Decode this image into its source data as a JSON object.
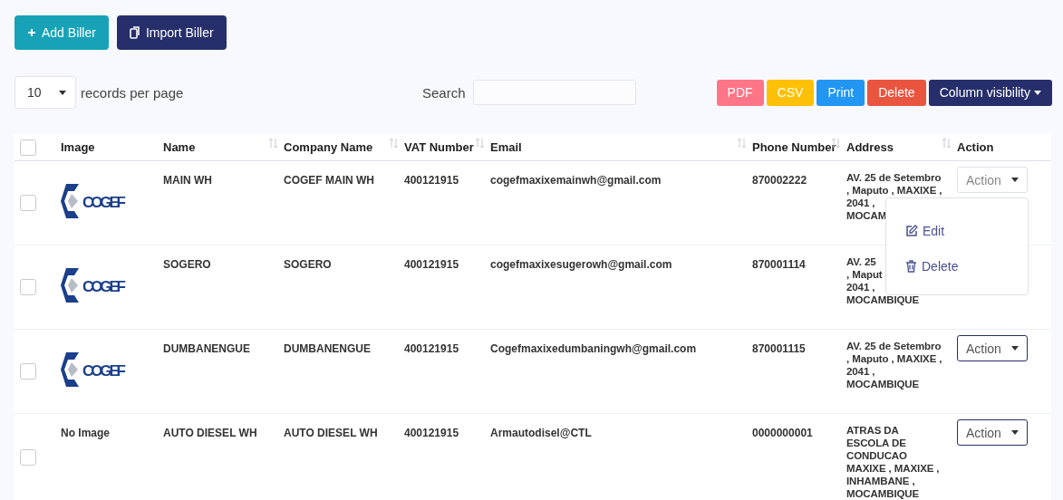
{
  "top_buttons": [
    {
      "kind": "add",
      "label": "Add Biller"
    },
    {
      "kind": "import",
      "label": "Import Biller"
    }
  ],
  "page_size": {
    "value": "10",
    "label": "records per page"
  },
  "search": {
    "label": "Search"
  },
  "export_buttons": [
    {
      "kind": "pdf",
      "label": "PDF"
    },
    {
      "kind": "csv",
      "label": "CSV"
    },
    {
      "kind": "print",
      "label": "Print"
    },
    {
      "kind": "delete",
      "label": "Delete"
    },
    {
      "kind": "columns",
      "label": "Column visibility"
    }
  ],
  "table": {
    "select_all": {
      "checked": false
    },
    "columns": [
      {
        "label": "Image",
        "sortable": false
      },
      {
        "label": "Name",
        "sortable": true
      },
      {
        "label": "Company Name",
        "sortable": true
      },
      {
        "label": "VAT Number",
        "sortable": true
      },
      {
        "label": "Email",
        "sortable": true
      },
      {
        "label": "Phone Number",
        "sortable": true
      },
      {
        "label": "Address",
        "sortable": true
      },
      {
        "label": "Action",
        "sortable": false
      }
    ],
    "rows": [
      {
        "checked": false,
        "image": {
          "kind": "logo",
          "text": "COGEF"
        },
        "name": "MAIN WH",
        "company": "COGEF MAIN WH",
        "vat": "400121915",
        "email": "cogefmaxixemainwh@gmail.com",
        "phone": "870002222",
        "address": [
          "AV. 25 de Setembro",
          ", Maputo , MAXIXE ,",
          "2041 ,",
          "MOCAM"
        ],
        "action": "Action",
        "open": true,
        "menu": [
          {
            "kind": "edit",
            "label": "Edit"
          },
          {
            "kind": "delete",
            "label": "Delete"
          }
        ]
      },
      {
        "checked": false,
        "image": {
          "kind": "logo",
          "text": "COGEF"
        },
        "name": "SOGERO",
        "company": "SOGERO",
        "vat": "400121915",
        "email": "cogefmaxixesugerowh@gmail.com",
        "phone": "870001114",
        "address": [
          "AV. 25",
          ", Maput",
          "2041 ,",
          "MOCAMBIQUE"
        ],
        "open": false
      },
      {
        "checked": false,
        "image": {
          "kind": "logo",
          "text": "COGEF"
        },
        "name": "DUMBANENGUE",
        "company": "DUMBANENGUE",
        "vat": "400121915",
        "email": "Cogefmaxixedumbaningwh@gmail.com",
        "phone": "870001115",
        "address": [
          "AV. 25 de Setembro",
          ", Maputo , MAXIXE ,",
          "2041 ,",
          "MOCAMBIQUE"
        ],
        "action": "Action",
        "open": false
      },
      {
        "checked": false,
        "image": {
          "kind": "none",
          "text": "No Image"
        },
        "name": "AUTO DIESEL WH",
        "company": "AUTO DIESEL WH",
        "vat": "400121915",
        "email": "Armautodisel@CTL",
        "phone": "0000000001",
        "address": [
          "ATRAS DA",
          "ESCOLA DE",
          "CONDUCAO",
          "MAXIXE , MAXIXE ,",
          "INHAMBANE ,",
          "MOCAMBIQUE"
        ],
        "action": "Action",
        "open": false
      }
    ]
  }
}
